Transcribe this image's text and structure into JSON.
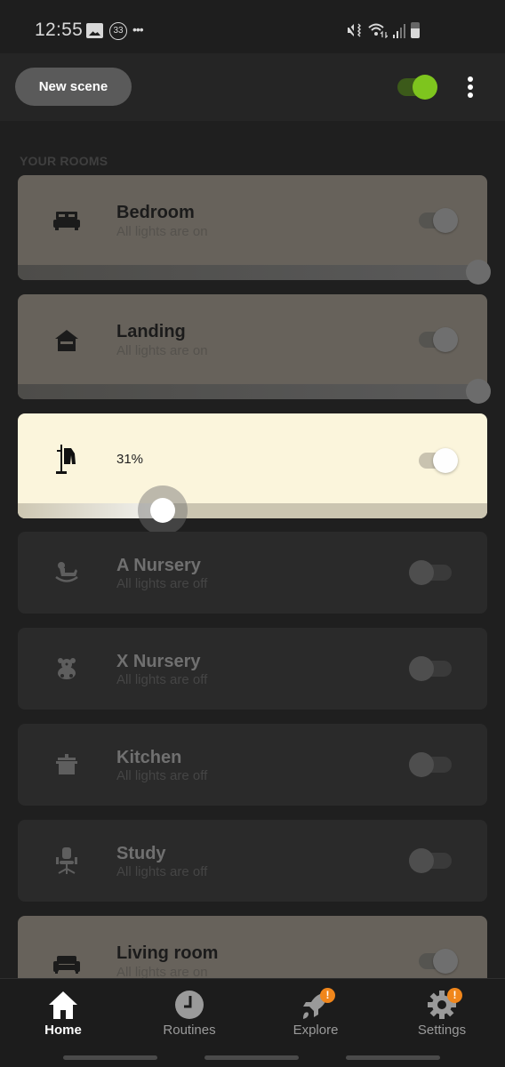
{
  "status_bar": {
    "time": "12:55",
    "notification_count": "33",
    "more_notifications": "•••",
    "icons": [
      "gallery-icon",
      "notification-count-icon",
      "mute-vibrate-icon",
      "wifi-icon",
      "signal-icon",
      "battery-icon"
    ]
  },
  "top_bar": {
    "new_scene_label": "New scene",
    "master_toggle_on": true,
    "more_icon": "more-vertical-icon",
    "accent_color": "#7ec51e"
  },
  "rooms_section": {
    "label": "YOUR ROOMS",
    "rooms": [
      {
        "name": "Bedroom",
        "status": "All lights are on",
        "state": "on",
        "icon": "bed-icon",
        "brightness_pct": 100
      },
      {
        "name": "Landing",
        "status": "All lights are on",
        "state": "on",
        "icon": "house-icon",
        "brightness_pct": 100
      },
      {
        "name": "",
        "status": "31%",
        "state": "active",
        "icon": "coat-rack-icon",
        "brightness_pct": 31
      },
      {
        "name": "A Nursery",
        "status": "All lights are off",
        "state": "off",
        "icon": "rocking-horse-icon"
      },
      {
        "name": "X Nursery",
        "status": "All lights are off",
        "state": "off",
        "icon": "teddy-bear-icon"
      },
      {
        "name": "Kitchen",
        "status": "All lights are off",
        "state": "off",
        "icon": "cooking-pot-icon"
      },
      {
        "name": "Study",
        "status": "All lights are off",
        "state": "off",
        "icon": "office-chair-icon"
      },
      {
        "name": "Living room",
        "status": "All lights are on",
        "state": "on",
        "icon": "sofa-icon"
      }
    ]
  },
  "bottom_nav": {
    "items": [
      {
        "label": "Home",
        "icon": "home-icon",
        "selected": true,
        "badge": null
      },
      {
        "label": "Routines",
        "icon": "clock-icon",
        "selected": false,
        "badge": null
      },
      {
        "label": "Explore",
        "icon": "rocket-icon",
        "selected": false,
        "badge": "!"
      },
      {
        "label": "Settings",
        "icon": "gear-icon",
        "selected": false,
        "badge": "!"
      }
    ],
    "badge_color": "#f0861b"
  }
}
